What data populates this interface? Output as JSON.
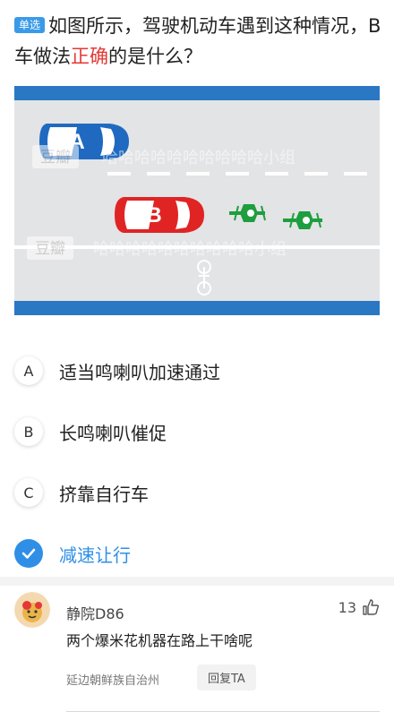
{
  "question": {
    "tag": "单选",
    "text_part1": "如图所示，驾驶机动车遇到这种情况，B车做法",
    "text_highlight": "正确",
    "text_part2": "的是什么？"
  },
  "scene": {
    "car_a_label": "A",
    "car_b_label": "B",
    "watermark_brand": "豆瓣",
    "watermark_text": "哈哈哈哈哈哈哈哈哈哈小组",
    "bike_label": "非机动车",
    "colors": {
      "lane_blue": "#2a78c4",
      "road_grey": "#e3e4e6",
      "car_a": "#1f6ac0",
      "car_b": "#e02424",
      "cyclist": "#1e9e3e"
    }
  },
  "options": [
    {
      "letter": "A",
      "text": "适当鸣喇叭加速通过",
      "correct": false
    },
    {
      "letter": "B",
      "text": "长鸣喇叭催促",
      "correct": false
    },
    {
      "letter": "C",
      "text": "挤靠自行车",
      "correct": false
    },
    {
      "letter": "check-icon",
      "text": "减速让行",
      "correct": true
    }
  ],
  "comment": {
    "username": "静院D86",
    "likes": "13",
    "text": "两个爆米花机器在路上干啥呢",
    "location": "延边朝鲜族自治州",
    "reply_label": "回复TA"
  }
}
